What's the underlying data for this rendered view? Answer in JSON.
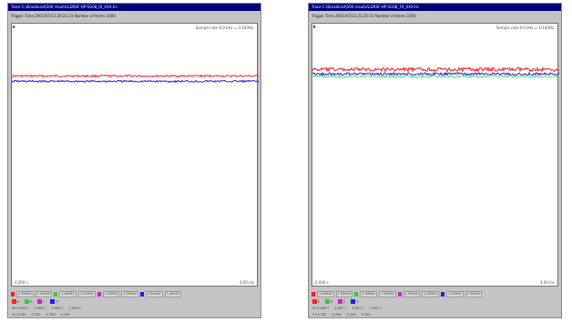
{
  "windows": [
    {
      "title": "Trace  C:\\Broadcast\\500 results\\LDRSF-HP-SG08_IR_XXX.trc",
      "info": "Trigger Time  2001/07/13  20:21:21    Number of Items  1000",
      "sample_rate": "Sample rate 8.0 kHz  =  1/100Hz",
      "time_start": "0.000 s",
      "time_end": "4.00 ms",
      "channel_strip": {
        "ch_labels": [
          "a",
          "b",
          "c",
          "d"
        ],
        "scales": [
          "1.5094V",
          "1.5094V",
          "1.5094V",
          "1.5094V",
          "1.5094V",
          "1.5094V",
          "1.5094V",
          "1.5094V",
          "1.5094V",
          "1.5094V"
        ]
      },
      "readouts": {
        "row1_labels": [
          "a",
          "b",
          "c",
          "d"
        ],
        "row2": [
          "Ya  1.993 T",
          "1.994 T",
          "1.994 T",
          "1.994 T"
        ],
        "row3": [
          "Y1  0.750",
          "0.750",
          "0.750",
          "0.750"
        ]
      },
      "traces": [
        {
          "name": "red",
          "color": "#ff2a2a",
          "level": 0.8,
          "noise": 0.004
        },
        {
          "name": "blue",
          "color": "#3030e0",
          "level": 0.78,
          "noise": 0.004
        }
      ]
    },
    {
      "title": "Trace  C:\\Broadcast\\500 results\\LDRSF-HP-SG08_TR_XXX.trc",
      "info": "Trigger Time  2001/07/13  21:15:15    Number of Items  1000",
      "sample_rate": "Sample rate 8.0 kHz  =  1/100Hz",
      "time_start": "0.000 s",
      "time_end": "4.00 ms",
      "channel_strip": {
        "ch_labels": [
          "a",
          "b",
          "c",
          "d"
        ],
        "scales": [
          "1.5094V",
          "1.5094V",
          "1.5094V",
          "1.5094V",
          "1.5094V",
          "1.5094V",
          "1.5094V",
          "1.5094V",
          "1.5094V",
          "1.5094V"
        ]
      },
      "readouts": {
        "row1_labels": [
          "a",
          "b",
          "c",
          "d"
        ],
        "row2": [
          "Ya  2.098 T",
          "2.097 T",
          "2.097 T",
          "2.097 T"
        ],
        "row3": [
          "Y1  0.750",
          "0.750",
          "0.750",
          "0.750"
        ]
      },
      "traces": [
        {
          "name": "red",
          "color": "#ff2020",
          "level": 0.825,
          "noise": 0.007
        },
        {
          "name": "blue",
          "color": "#2626dd",
          "level": 0.808,
          "noise": 0.005
        },
        {
          "name": "green",
          "color": "#5fe08a",
          "level": 0.798,
          "noise": 0.005
        }
      ]
    }
  ],
  "colors": {
    "ch_a": "#ff2020",
    "ch_b": "#2ecc40",
    "ch_c": "#d020d0",
    "ch_d": "#2020e0"
  }
}
